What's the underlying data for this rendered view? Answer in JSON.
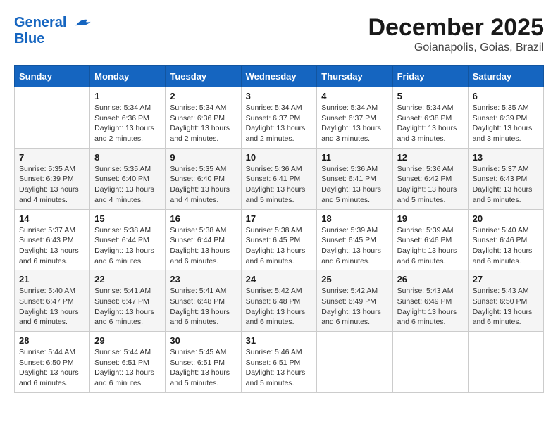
{
  "header": {
    "logo_line1": "General",
    "logo_line2": "Blue",
    "month_title": "December 2025",
    "location": "Goianapolis, Goias, Brazil"
  },
  "days_of_week": [
    "Sunday",
    "Monday",
    "Tuesday",
    "Wednesday",
    "Thursday",
    "Friday",
    "Saturday"
  ],
  "weeks": [
    [
      {
        "day": "",
        "info": ""
      },
      {
        "day": "1",
        "info": "Sunrise: 5:34 AM\nSunset: 6:36 PM\nDaylight: 13 hours\nand 2 minutes."
      },
      {
        "day": "2",
        "info": "Sunrise: 5:34 AM\nSunset: 6:36 PM\nDaylight: 13 hours\nand 2 minutes."
      },
      {
        "day": "3",
        "info": "Sunrise: 5:34 AM\nSunset: 6:37 PM\nDaylight: 13 hours\nand 2 minutes."
      },
      {
        "day": "4",
        "info": "Sunrise: 5:34 AM\nSunset: 6:37 PM\nDaylight: 13 hours\nand 3 minutes."
      },
      {
        "day": "5",
        "info": "Sunrise: 5:34 AM\nSunset: 6:38 PM\nDaylight: 13 hours\nand 3 minutes."
      },
      {
        "day": "6",
        "info": "Sunrise: 5:35 AM\nSunset: 6:39 PM\nDaylight: 13 hours\nand 3 minutes."
      }
    ],
    [
      {
        "day": "7",
        "info": "Sunrise: 5:35 AM\nSunset: 6:39 PM\nDaylight: 13 hours\nand 4 minutes."
      },
      {
        "day": "8",
        "info": "Sunrise: 5:35 AM\nSunset: 6:40 PM\nDaylight: 13 hours\nand 4 minutes."
      },
      {
        "day": "9",
        "info": "Sunrise: 5:35 AM\nSunset: 6:40 PM\nDaylight: 13 hours\nand 4 minutes."
      },
      {
        "day": "10",
        "info": "Sunrise: 5:36 AM\nSunset: 6:41 PM\nDaylight: 13 hours\nand 5 minutes."
      },
      {
        "day": "11",
        "info": "Sunrise: 5:36 AM\nSunset: 6:41 PM\nDaylight: 13 hours\nand 5 minutes."
      },
      {
        "day": "12",
        "info": "Sunrise: 5:36 AM\nSunset: 6:42 PM\nDaylight: 13 hours\nand 5 minutes."
      },
      {
        "day": "13",
        "info": "Sunrise: 5:37 AM\nSunset: 6:43 PM\nDaylight: 13 hours\nand 5 minutes."
      }
    ],
    [
      {
        "day": "14",
        "info": "Sunrise: 5:37 AM\nSunset: 6:43 PM\nDaylight: 13 hours\nand 6 minutes."
      },
      {
        "day": "15",
        "info": "Sunrise: 5:38 AM\nSunset: 6:44 PM\nDaylight: 13 hours\nand 6 minutes."
      },
      {
        "day": "16",
        "info": "Sunrise: 5:38 AM\nSunset: 6:44 PM\nDaylight: 13 hours\nand 6 minutes."
      },
      {
        "day": "17",
        "info": "Sunrise: 5:38 AM\nSunset: 6:45 PM\nDaylight: 13 hours\nand 6 minutes."
      },
      {
        "day": "18",
        "info": "Sunrise: 5:39 AM\nSunset: 6:45 PM\nDaylight: 13 hours\nand 6 minutes."
      },
      {
        "day": "19",
        "info": "Sunrise: 5:39 AM\nSunset: 6:46 PM\nDaylight: 13 hours\nand 6 minutes."
      },
      {
        "day": "20",
        "info": "Sunrise: 5:40 AM\nSunset: 6:46 PM\nDaylight: 13 hours\nand 6 minutes."
      }
    ],
    [
      {
        "day": "21",
        "info": "Sunrise: 5:40 AM\nSunset: 6:47 PM\nDaylight: 13 hours\nand 6 minutes."
      },
      {
        "day": "22",
        "info": "Sunrise: 5:41 AM\nSunset: 6:47 PM\nDaylight: 13 hours\nand 6 minutes."
      },
      {
        "day": "23",
        "info": "Sunrise: 5:41 AM\nSunset: 6:48 PM\nDaylight: 13 hours\nand 6 minutes."
      },
      {
        "day": "24",
        "info": "Sunrise: 5:42 AM\nSunset: 6:48 PM\nDaylight: 13 hours\nand 6 minutes."
      },
      {
        "day": "25",
        "info": "Sunrise: 5:42 AM\nSunset: 6:49 PM\nDaylight: 13 hours\nand 6 minutes."
      },
      {
        "day": "26",
        "info": "Sunrise: 5:43 AM\nSunset: 6:49 PM\nDaylight: 13 hours\nand 6 minutes."
      },
      {
        "day": "27",
        "info": "Sunrise: 5:43 AM\nSunset: 6:50 PM\nDaylight: 13 hours\nand 6 minutes."
      }
    ],
    [
      {
        "day": "28",
        "info": "Sunrise: 5:44 AM\nSunset: 6:50 PM\nDaylight: 13 hours\nand 6 minutes."
      },
      {
        "day": "29",
        "info": "Sunrise: 5:44 AM\nSunset: 6:51 PM\nDaylight: 13 hours\nand 6 minutes."
      },
      {
        "day": "30",
        "info": "Sunrise: 5:45 AM\nSunset: 6:51 PM\nDaylight: 13 hours\nand 5 minutes."
      },
      {
        "day": "31",
        "info": "Sunrise: 5:46 AM\nSunset: 6:51 PM\nDaylight: 13 hours\nand 5 minutes."
      },
      {
        "day": "",
        "info": ""
      },
      {
        "day": "",
        "info": ""
      },
      {
        "day": "",
        "info": ""
      }
    ]
  ]
}
